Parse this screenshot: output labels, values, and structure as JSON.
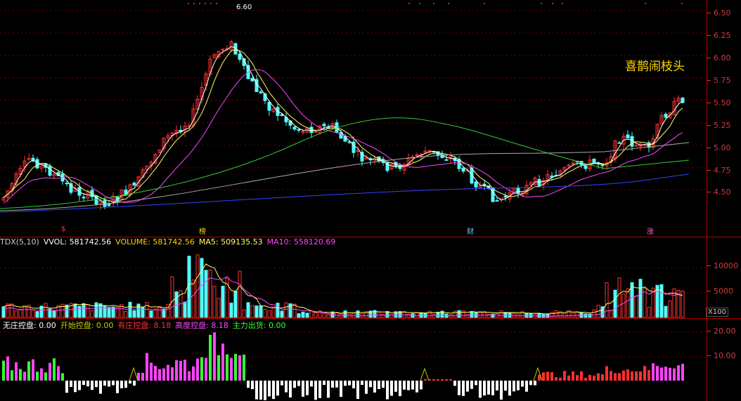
{
  "price_chart": {
    "peak_label": "6.60",
    "caption": "喜鹊闹枝头",
    "ticks": [
      "6.50",
      "6.25",
      "6.00",
      "5.75",
      "5.50",
      "5.25",
      "5.00",
      "4.75",
      "4.50"
    ],
    "markers": [
      {
        "text": "$",
        "color": "#ff4040"
      },
      {
        "text": "榜",
        "color": "#ffd700"
      },
      {
        "text": "财",
        "color": "#66ccff"
      },
      {
        "text": "涨",
        "color": "#ff66cc"
      }
    ]
  },
  "volume_panel": {
    "legend": [
      {
        "text": "TDX(5,10)",
        "color": "#cccccc"
      },
      {
        "text": "VVOL: 581742.56",
        "color": "#ffffff"
      },
      {
        "text": "VOLUME: 581742.56",
        "color": "#ffd700"
      },
      {
        "text": "MA5: 509135.53",
        "color": "#ffff66"
      },
      {
        "text": "MA10: 558120.69",
        "color": "#ff44ff"
      }
    ],
    "ticks": [
      "10000",
      "5000"
    ],
    "unit": "X100"
  },
  "indicator_panel": {
    "legend": [
      {
        "text": "无庄控盘: 0.00",
        "color": "#ffffff"
      },
      {
        "text": "开始控盘: 0.00",
        "color": "#c8c800"
      },
      {
        "text": "有庄控盘: 8.18",
        "color": "#ff3030"
      },
      {
        "text": "高度控盘: 8.18",
        "color": "#ff44ff"
      },
      {
        "text": "主力出货: 0.00",
        "color": "#33ff33"
      }
    ],
    "ticks": [
      "20.00",
      "10.00"
    ]
  },
  "colors": {
    "up": "#ff3232",
    "down": "#54ffff",
    "grid": "#b00000",
    "ma_white": "#ffffff",
    "ma_yellow": "#ffff66",
    "ma_magenta": "#ff44ff",
    "ma_green": "#33cc33",
    "ma_gray": "#aaaaaa",
    "ma_blue": "#3344ff"
  }
}
